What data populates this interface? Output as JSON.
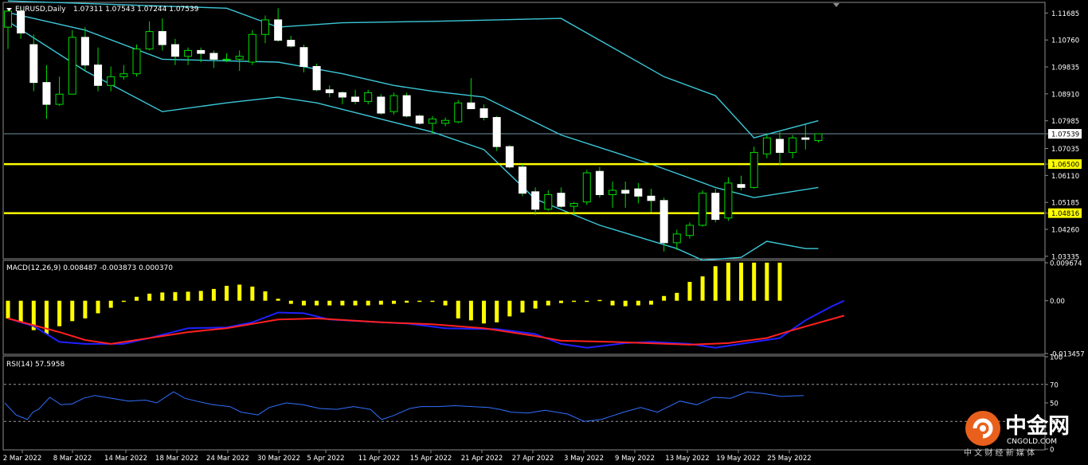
{
  "header": {
    "symbol": "EURUSD,Daily",
    "ohlc": "1.07311 1.07543 1.07244 1.07539"
  },
  "macd": {
    "label": "MACD(12,26,9) 0.008487 -0.003873 0.000370"
  },
  "rsi": {
    "label": "RSI(14) 57.5958"
  },
  "price_scale": [
    "1.11685",
    "1.10760",
    "1.09835",
    "1.08910",
    "1.07985",
    "1.07539",
    "1.07035",
    "1.06500",
    "1.06110",
    "1.05185",
    "1.04816",
    "1.04260",
    "1.03335"
  ],
  "macd_scale": [
    "0.009674",
    "0.00",
    "-0.013457"
  ],
  "rsi_scale": [
    "100",
    "70",
    "50",
    "30",
    "0"
  ],
  "dates": [
    "2 Mar 2022",
    "8 Mar 2022",
    "14 Mar 2022",
    "18 Mar 2022",
    "24 Mar 2022",
    "30 Mar 2022",
    "5 Apr 2022",
    "11 Apr 2022",
    "15 Apr 2022",
    "21 Apr 2022",
    "27 Apr 2022",
    "3 May 2022",
    "9 May 2022",
    "13 May 2022",
    "19 May 2022",
    "25 May 2022"
  ],
  "logo": {
    "name": "中金网",
    "site": "CNGOLD.COM",
    "tagline": "中 文 财 经 新 媒 体"
  },
  "colors": {
    "background": "#000000",
    "candle": "#ffffff",
    "bollinger": "#3cc8d8",
    "level": "#ffff00",
    "macd_hist": "#ffff00",
    "macd_main": "#2020ff",
    "macd_signal": "#ff2020",
    "rsi": "#3070ff"
  },
  "chart_data": {
    "type": "candlestick",
    "symbol": "EURUSD",
    "timeframe": "Daily",
    "price_range": [
      1.0325,
      1.1205
    ],
    "levels": [
      1.065,
      1.04816
    ],
    "current_price": 1.07539,
    "candles": [
      {
        "o": 1.112,
        "h": 1.1185,
        "l": 1.1045,
        "c": 1.1175
      },
      {
        "o": 1.1175,
        "h": 1.119,
        "l": 1.108,
        "c": 1.11
      },
      {
        "o": 1.106,
        "h": 1.1095,
        "l": 1.09,
        "c": 1.093
      },
      {
        "o": 1.093,
        "h": 1.099,
        "l": 1.0805,
        "c": 1.0855
      },
      {
        "o": 1.0855,
        "h": 1.095,
        "l": 1.085,
        "c": 1.089
      },
      {
        "o": 1.089,
        "h": 1.111,
        "l": 1.089,
        "c": 1.1085
      },
      {
        "o": 1.1085,
        "h": 1.112,
        "l": 1.097,
        "c": 1.099
      },
      {
        "o": 1.099,
        "h": 1.105,
        "l": 1.09,
        "c": 1.092
      },
      {
        "o": 1.092,
        "h": 1.0985,
        "l": 1.09,
        "c": 1.095
      },
      {
        "o": 1.095,
        "h": 1.099,
        "l": 1.094,
        "c": 1.096
      },
      {
        "o": 1.096,
        "h": 1.106,
        "l": 1.095,
        "c": 1.1045
      },
      {
        "o": 1.1045,
        "h": 1.114,
        "l": 1.104,
        "c": 1.1105
      },
      {
        "o": 1.1105,
        "h": 1.115,
        "l": 1.104,
        "c": 1.106
      },
      {
        "o": 1.106,
        "h": 1.108,
        "l": 1.099,
        "c": 1.102
      },
      {
        "o": 1.102,
        "h": 1.105,
        "l": 1.099,
        "c": 1.104
      },
      {
        "o": 1.104,
        "h": 1.105,
        "l": 1.1,
        "c": 1.103
      },
      {
        "o": 1.103,
        "h": 1.104,
        "l": 1.098,
        "c": 1.101
      },
      {
        "o": 1.101,
        "h": 1.103,
        "l": 1.1,
        "c": 1.101
      },
      {
        "o": 1.101,
        "h": 1.104,
        "l": 1.097,
        "c": 1.102
      },
      {
        "o": 1.1,
        "h": 1.111,
        "l": 1.099,
        "c": 1.1095
      },
      {
        "o": 1.1095,
        "h": 1.116,
        "l": 1.1065,
        "c": 1.1145
      },
      {
        "o": 1.1145,
        "h": 1.1185,
        "l": 1.107,
        "c": 1.1075
      },
      {
        "o": 1.1075,
        "h": 1.109,
        "l": 1.105,
        "c": 1.1055
      },
      {
        "o": 1.105,
        "h": 1.106,
        "l": 1.0965,
        "c": 1.0985
      },
      {
        "o": 1.0985,
        "h": 1.0995,
        "l": 1.09,
        "c": 1.0905
      },
      {
        "o": 1.0905,
        "h": 1.092,
        "l": 1.088,
        "c": 1.0895
      },
      {
        "o": 1.0895,
        "h": 1.09,
        "l": 1.0855,
        "c": 1.088
      },
      {
        "o": 1.088,
        "h": 1.0905,
        "l": 1.0855,
        "c": 1.0865
      },
      {
        "o": 1.0865,
        "h": 1.0905,
        "l": 1.0855,
        "c": 1.0895
      },
      {
        "o": 1.088,
        "h": 1.089,
        "l": 1.082,
        "c": 1.0825
      },
      {
        "o": 1.083,
        "h": 1.0895,
        "l": 1.082,
        "c": 1.0885
      },
      {
        "o": 1.0885,
        "h": 1.0895,
        "l": 1.081,
        "c": 1.0815
      },
      {
        "o": 1.0815,
        "h": 1.082,
        "l": 1.0785,
        "c": 1.079
      },
      {
        "o": 1.079,
        "h": 1.0815,
        "l": 1.0755,
        "c": 1.0805
      },
      {
        "o": 1.079,
        "h": 1.081,
        "l": 1.078,
        "c": 1.08
      },
      {
        "o": 1.0795,
        "h": 1.087,
        "l": 1.079,
        "c": 1.086
      },
      {
        "o": 1.086,
        "h": 1.0945,
        "l": 1.085,
        "c": 1.084
      },
      {
        "o": 1.084,
        "h": 1.0855,
        "l": 1.08,
        "c": 1.081
      },
      {
        "o": 1.081,
        "h": 1.0815,
        "l": 1.0695,
        "c": 1.071
      },
      {
        "o": 1.071,
        "h": 1.0715,
        "l": 1.0635,
        "c": 1.064
      },
      {
        "o": 1.064,
        "h": 1.065,
        "l": 1.054,
        "c": 1.055
      },
      {
        "o": 1.0555,
        "h": 1.057,
        "l": 1.0475,
        "c": 1.0495
      },
      {
        "o": 1.0495,
        "h": 1.056,
        "l": 1.049,
        "c": 1.0545
      },
      {
        "o": 1.055,
        "h": 1.057,
        "l": 1.05,
        "c": 1.0505
      },
      {
        "o": 1.0505,
        "h": 1.052,
        "l": 1.0475,
        "c": 1.0515
      },
      {
        "o": 1.052,
        "h": 1.063,
        "l": 1.051,
        "c": 1.062
      },
      {
        "o": 1.0625,
        "h": 1.064,
        "l": 1.0535,
        "c": 1.0545
      },
      {
        "o": 1.0545,
        "h": 1.059,
        "l": 1.05,
        "c": 1.056
      },
      {
        "o": 1.056,
        "h": 1.059,
        "l": 1.05,
        "c": 1.055
      },
      {
        "o": 1.0565,
        "h": 1.0585,
        "l": 1.0515,
        "c": 1.054
      },
      {
        "o": 1.054,
        "h": 1.0565,
        "l": 1.0485,
        "c": 1.0525
      },
      {
        "o": 1.0525,
        "h": 1.0535,
        "l": 1.035,
        "c": 1.038
      },
      {
        "o": 1.038,
        "h": 1.0425,
        "l": 1.0355,
        "c": 1.041
      },
      {
        "o": 1.0405,
        "h": 1.045,
        "l": 1.0395,
        "c": 1.044
      },
      {
        "o": 1.044,
        "h": 1.056,
        "l": 1.0435,
        "c": 1.055
      },
      {
        "o": 1.055,
        "h": 1.0565,
        "l": 1.045,
        "c": 1.046
      },
      {
        "o": 1.0465,
        "h": 1.0605,
        "l": 1.0455,
        "c": 1.0585
      },
      {
        "o": 1.058,
        "h": 1.061,
        "l": 1.056,
        "c": 1.057
      },
      {
        "o": 1.057,
        "h": 1.071,
        "l": 1.0565,
        "c": 1.069
      },
      {
        "o": 1.0685,
        "h": 1.075,
        "l": 1.067,
        "c": 1.074
      },
      {
        "o": 1.0735,
        "h": 1.076,
        "l": 1.0645,
        "c": 1.069
      },
      {
        "o": 1.069,
        "h": 1.075,
        "l": 1.067,
        "c": 1.074
      },
      {
        "o": 1.074,
        "h": 1.0785,
        "l": 1.07,
        "c": 1.0735
      },
      {
        "o": 1.0731,
        "h": 1.0754,
        "l": 1.0724,
        "c": 1.0754
      }
    ],
    "bollinger_upper": [
      [
        0,
        1.121
      ],
      [
        17,
        1.1185
      ],
      [
        21,
        1.112
      ],
      [
        26,
        1.1135
      ],
      [
        33,
        1.114
      ],
      [
        43,
        1.115
      ],
      [
        51,
        1.095
      ],
      [
        55,
        1.0885
      ],
      [
        58,
        1.074
      ],
      [
        63,
        1.0799
      ]
    ],
    "bollinger_middle": [
      [
        0,
        1.117
      ],
      [
        6,
        1.111
      ],
      [
        12,
        1.101
      ],
      [
        21,
        1.1
      ],
      [
        26,
        1.096
      ],
      [
        30,
        1.092
      ],
      [
        33,
        1.09
      ],
      [
        37,
        1.088
      ],
      [
        43,
        1.075
      ],
      [
        50,
        1.065
      ],
      [
        55,
        1.057
      ],
      [
        58,
        1.0535
      ],
      [
        63,
        1.057
      ]
    ],
    "bollinger_lower": [
      [
        0,
        1.114
      ],
      [
        6,
        1.097
      ],
      [
        12,
        1.083
      ],
      [
        17,
        1.086
      ],
      [
        21,
        1.088
      ],
      [
        24,
        1.086
      ],
      [
        33,
        1.076
      ],
      [
        37,
        1.07
      ],
      [
        41,
        1.053
      ],
      [
        46,
        1.044
      ],
      [
        52,
        1.036
      ],
      [
        54,
        1.032
      ],
      [
        57,
        1.033
      ],
      [
        59,
        1.0385
      ],
      [
        62,
        1.036
      ],
      [
        63,
        1.036
      ]
    ],
    "macd": {
      "range": [
        -0.013457,
        0.009674
      ],
      "histogram": [
        -0.0045,
        -0.0055,
        -0.0075,
        -0.0085,
        -0.0065,
        -0.0052,
        -0.0045,
        -0.0032,
        -0.0018,
        -0.0003,
        0.001,
        0.0018,
        0.0021,
        0.0022,
        0.0023,
        0.0025,
        0.003,
        0.0038,
        0.0041,
        0.0036,
        0.0024,
        0.0005,
        -0.0008,
        -0.0012,
        -0.0012,
        -0.0012,
        -0.0012,
        -0.0012,
        -0.0012,
        -0.001,
        -0.0008,
        -0.0005,
        -0.0003,
        -0.0003,
        -0.0012,
        -0.0045,
        -0.005,
        -0.0058,
        -0.0055,
        -0.004,
        -0.003,
        -0.002,
        -0.0012,
        -0.0006,
        -0.0003,
        0.0,
        0.0002,
        -0.0012,
        -0.0014,
        -0.0012,
        -0.001,
        0.0012,
        0.002,
        0.0048,
        0.0062,
        0.0088,
        0.0097,
        0.0097,
        0.0097,
        0.0097,
        0.0097
      ],
      "main": [
        [
          0,
          -0.0045
        ],
        [
          2,
          -0.0065
        ],
        [
          4,
          -0.0105
        ],
        [
          6,
          -0.011
        ],
        [
          9,
          -0.011
        ],
        [
          11,
          -0.0095
        ],
        [
          14,
          -0.007
        ],
        [
          17,
          -0.0068
        ],
        [
          19,
          -0.0055
        ],
        [
          21,
          -0.003
        ],
        [
          23,
          -0.0032
        ],
        [
          25,
          -0.0048
        ],
        [
          29,
          -0.0055
        ],
        [
          31,
          -0.0058
        ],
        [
          34,
          -0.007
        ],
        [
          37,
          -0.0072
        ],
        [
          38,
          -0.0072
        ],
        [
          41,
          -0.0085
        ],
        [
          43,
          -0.011
        ],
        [
          45,
          -0.012
        ],
        [
          48,
          -0.0108
        ],
        [
          50,
          -0.0105
        ],
        [
          53,
          -0.011
        ],
        [
          55,
          -0.012
        ],
        [
          57,
          -0.011
        ],
        [
          60,
          -0.0095
        ],
        [
          62,
          -0.005
        ],
        [
          64,
          -0.0015
        ],
        [
          65,
          0.0
        ]
      ],
      "signal": [
        [
          0,
          -0.0045
        ],
        [
          4,
          -0.008
        ],
        [
          6,
          -0.01
        ],
        [
          8,
          -0.011
        ],
        [
          10,
          -0.01
        ],
        [
          14,
          -0.008
        ],
        [
          17,
          -0.007
        ],
        [
          21,
          -0.0048
        ],
        [
          24,
          -0.0045
        ],
        [
          29,
          -0.0055
        ],
        [
          33,
          -0.006
        ],
        [
          37,
          -0.007
        ],
        [
          41,
          -0.009
        ],
        [
          43,
          -0.0102
        ],
        [
          47,
          -0.0105
        ],
        [
          53,
          -0.0112
        ],
        [
          56,
          -0.0108
        ],
        [
          59,
          -0.0095
        ],
        [
          61,
          -0.0075
        ],
        [
          65,
          -0.0038
        ]
      ]
    },
    "rsi": {
      "range": [
        0,
        100
      ],
      "levels": [
        70,
        30
      ],
      "values": [
        [
          0,
          50
        ],
        [
          2,
          37
        ],
        [
          4,
          32
        ],
        [
          5,
          40
        ],
        [
          6,
          43
        ],
        [
          8,
          56
        ],
        [
          10,
          48
        ],
        [
          12,
          49
        ],
        [
          14,
          55
        ],
        [
          16,
          58
        ],
        [
          19,
          55
        ],
        [
          22,
          52
        ],
        [
          25,
          53
        ],
        [
          27,
          50
        ],
        [
          29,
          58
        ],
        [
          30,
          62
        ],
        [
          32,
          55
        ],
        [
          34,
          52
        ],
        [
          37,
          48
        ],
        [
          40,
          46
        ],
        [
          42,
          40
        ],
        [
          45,
          37
        ],
        [
          47,
          45
        ],
        [
          50,
          50
        ],
        [
          53,
          48
        ],
        [
          56,
          44
        ],
        [
          59,
          43
        ],
        [
          62,
          46
        ],
        [
          65,
          43
        ],
        [
          67,
          32
        ],
        [
          69,
          36
        ],
        [
          72,
          44
        ],
        [
          74,
          46
        ],
        [
          77,
          46
        ],
        [
          80,
          47
        ],
        [
          83,
          46
        ],
        [
          86,
          45
        ],
        [
          88,
          43
        ],
        [
          90,
          40
        ],
        [
          93,
          39
        ],
        [
          96,
          42
        ],
        [
          100,
          38
        ],
        [
          103,
          30
        ],
        [
          106,
          32
        ],
        [
          110,
          40
        ],
        [
          113,
          45
        ],
        [
          116,
          40
        ],
        [
          120,
          52
        ],
        [
          123,
          48
        ],
        [
          126,
          56
        ],
        [
          129,
          55
        ],
        [
          132,
          62
        ],
        [
          135,
          60
        ],
        [
          138,
          57
        ],
        [
          142,
          58
        ]
      ]
    }
  }
}
